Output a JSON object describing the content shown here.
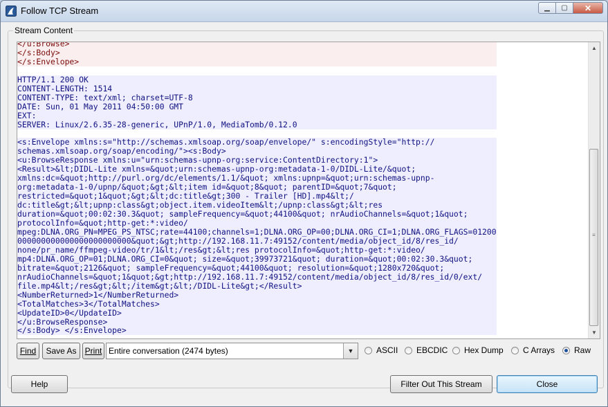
{
  "window": {
    "title": "Follow TCP Stream"
  },
  "group": {
    "label": "Stream Content"
  },
  "stream_lines": [
    {
      "t": "</u:Browse>",
      "s": "client"
    },
    {
      "t": "</s:Body>",
      "s": "client"
    },
    {
      "t": "</s:Envelope>",
      "s": "client"
    },
    {
      "t": "",
      "s": "blank"
    },
    {
      "t": "HTTP/1.1 200 OK",
      "s": "server"
    },
    {
      "t": "CONTENT-LENGTH: 1514",
      "s": "server"
    },
    {
      "t": "CONTENT-TYPE: text/xml; charset=UTF-8",
      "s": "server"
    },
    {
      "t": "DATE: Sun, 01 May 2011 04:50:00 GMT",
      "s": "server"
    },
    {
      "t": "EXT:",
      "s": "server"
    },
    {
      "t": "SERVER: Linux/2.6.35-28-generic, UPnP/1.0, MediaTomb/0.12.0",
      "s": "server"
    },
    {
      "t": "",
      "s": "blank"
    },
    {
      "t": "<s:Envelope xmlns:s=\"http://schemas.xmlsoap.org/soap/envelope/\" s:encodingStyle=\"http://",
      "s": "server"
    },
    {
      "t": "schemas.xmlsoap.org/soap/encoding/\"><s:Body>",
      "s": "server"
    },
    {
      "t": "<u:BrowseResponse xmlns:u=\"urn:schemas-upnp-org:service:ContentDirectory:1\">",
      "s": "server"
    },
    {
      "t": "<Result>&lt;DIDL-Lite xmlns=&quot;urn:schemas-upnp-org:metadata-1-0/DIDL-Lite/&quot;",
      "s": "server"
    },
    {
      "t": "xmlns:dc=&quot;http://purl.org/dc/elements/1.1/&quot; xmlns:upnp=&quot;urn:schemas-upnp-",
      "s": "server"
    },
    {
      "t": "org:metadata-1-0/upnp/&quot;&gt;&lt;item id=&quot;8&quot; parentID=&quot;7&quot;",
      "s": "server"
    },
    {
      "t": "restricted=&quot;1&quot;&gt;&lt;dc:title&gt;300 - Trailer [HD].mp4&lt;/",
      "s": "server"
    },
    {
      "t": "dc:title&gt;&lt;upnp:class&gt;object.item.videoItem&lt;/upnp:class&gt;&lt;res",
      "s": "server"
    },
    {
      "t": "duration=&quot;00:02:30.3&quot; sampleFrequency=&quot;44100&quot; nrAudioChannels=&quot;1&quot;",
      "s": "server"
    },
    {
      "t": "protocolInfo=&quot;http-get:*:video/",
      "s": "server"
    },
    {
      "t": "mpeg:DLNA.ORG_PN=MPEG_PS_NTSC;rate=44100;channels=1;DLNA.ORG_OP=00;DLNA.ORG_CI=1;DLNA.ORG_FLAGS=01200",
      "s": "server"
    },
    {
      "t": "000000000000000000000000&quot;&gt;http://192.168.11.7:49152/content/media/object_id/8/res_id/",
      "s": "server"
    },
    {
      "t": "none/pr_name/ffmpeg-video/tr/1&lt;/res&gt;&lt;res protocolInfo=&quot;http-get:*:video/",
      "s": "server"
    },
    {
      "t": "mp4:DLNA.ORG_OP=01;DLNA.ORG_CI=0&quot; size=&quot;39973721&quot; duration=&quot;00:02:30.3&quot;",
      "s": "server"
    },
    {
      "t": "bitrate=&quot;2126&quot; sampleFrequency=&quot;44100&quot; resolution=&quot;1280x720&quot;",
      "s": "server"
    },
    {
      "t": "nrAudioChannels=&quot;1&quot;&gt;http://192.168.11.7:49152/content/media/object_id/8/res_id/0/ext/",
      "s": "server"
    },
    {
      "t": "file.mp4&lt;/res&gt;&lt;/item&gt;&lt;/DIDL-Lite&gt;</Result>",
      "s": "server"
    },
    {
      "t": "<NumberReturned>1</NumberReturned>",
      "s": "server"
    },
    {
      "t": "<TotalMatches>3</TotalMatches>",
      "s": "server"
    },
    {
      "t": "<UpdateID>0</UpdateID>",
      "s": "server"
    },
    {
      "t": "</u:BrowseResponse>",
      "s": "server"
    },
    {
      "t": "</s:Body> </s:Envelope>",
      "s": "server"
    }
  ],
  "controls": {
    "find_label": "Find",
    "save_as_label": "Save As",
    "print_label": "Print",
    "conversation_selected": "Entire conversation (2474 bytes)",
    "radios": [
      {
        "label": "ASCII",
        "checked": false
      },
      {
        "label": "EBCDIC",
        "checked": false
      },
      {
        "label": "Hex Dump",
        "checked": false
      },
      {
        "label": "C Arrays",
        "checked": false
      },
      {
        "label": "Raw",
        "checked": true
      }
    ]
  },
  "footer": {
    "help_label": "Help",
    "filter_label": "Filter Out This Stream",
    "close_label": "Close"
  },
  "colors": {
    "client_text": "#7a0b0b",
    "client_bg": "#fbeeee",
    "server_text": "#101080",
    "server_bg": "#eeeeff"
  }
}
